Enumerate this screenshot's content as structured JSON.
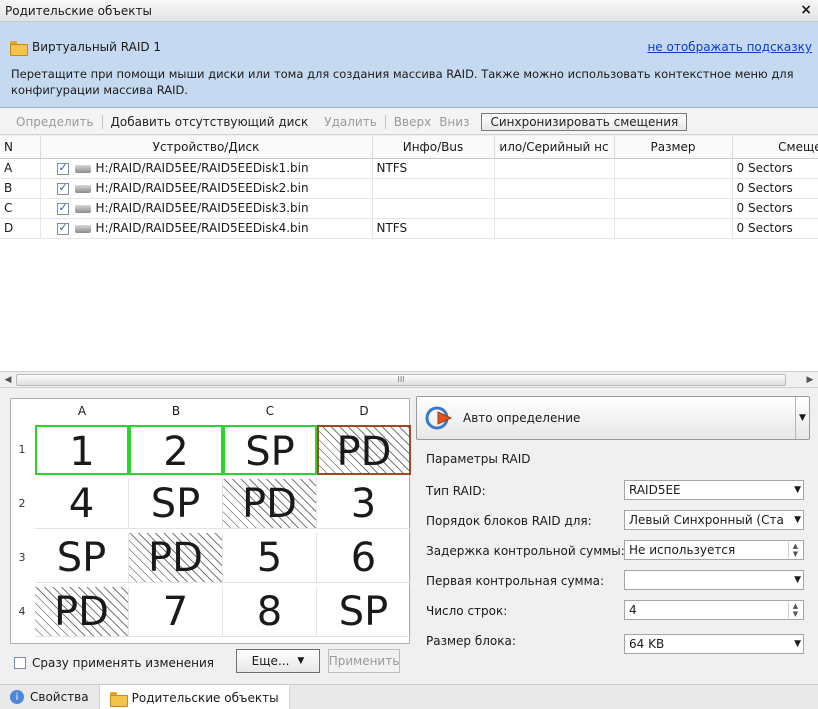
{
  "window": {
    "title": "Родительские объекты",
    "close": "×"
  },
  "hint": {
    "title": "Виртуальный RAID 1",
    "hide_link": "не отображать подсказку",
    "text": "Перетащите при помощи мыши диски или тома для создания массива RAID. Также можно использовать контекстное меню для конфигурации массива RAID."
  },
  "toolbar": {
    "detect": "Определить",
    "add_missing": "Добавить отсутствующий диск",
    "remove": "Удалить",
    "up": "Вверх",
    "down": "Вниз",
    "sync_offsets": "Синхронизировать смещения"
  },
  "grid": {
    "headers": [
      "N",
      "Устройство/Диск",
      "Инфо/Bus",
      "ило/Серийный нс",
      "Размер",
      "Смещен"
    ],
    "rows": [
      {
        "n": "A",
        "checked": true,
        "device": "H:/RAID/RAID5EE/RAID5EEDisk1.bin",
        "info": "NTFS",
        "serial": "",
        "size": "",
        "offset": "0 Sectors"
      },
      {
        "n": "B",
        "checked": true,
        "device": "H:/RAID/RAID5EE/RAID5EEDisk2.bin",
        "info": "",
        "serial": "",
        "size": "",
        "offset": "0 Sectors"
      },
      {
        "n": "C",
        "checked": true,
        "device": "H:/RAID/RAID5EE/RAID5EEDisk3.bin",
        "info": "",
        "serial": "",
        "size": "",
        "offset": "0 Sectors"
      },
      {
        "n": "D",
        "checked": true,
        "device": "H:/RAID/RAID5EE/RAID5EEDisk4.bin",
        "info": "NTFS",
        "serial": "",
        "size": "",
        "offset": "0 Sectors"
      }
    ],
    "scroll_thumb": "III"
  },
  "raid_map": {
    "columns": [
      "A",
      "B",
      "C",
      "D"
    ],
    "rows": [
      "1",
      "2",
      "3",
      "4"
    ],
    "cells": [
      [
        "1",
        "2",
        "SP",
        "PD"
      ],
      [
        "4",
        "SP",
        "PD",
        "3"
      ],
      [
        "SP",
        "PD",
        "5",
        "6"
      ],
      [
        "PD",
        "7",
        "8",
        "SP"
      ]
    ]
  },
  "bottom": {
    "apply_now": "Сразу применять изменения",
    "more": "Еще...",
    "apply": "Применить"
  },
  "params": {
    "auto_detect": "Авто определение",
    "title": "Параметры RAID",
    "raid_type_label": "Тип RAID:",
    "raid_type_value": "RAID5EE",
    "block_order_label": "Порядок блоков RAID для:",
    "block_order_value": "Левый Синхронный (Ста",
    "checksum_delay_label": "Задержка контрольной суммы:",
    "checksum_delay_value": "Не используется",
    "first_checksum_label": "Первая контрольная сумма:",
    "first_checksum_value": "",
    "rows_label": "Число строк:",
    "rows_value": "4",
    "block_size_label": "Размер блока:",
    "block_size_value": "64 KB"
  },
  "tabs": [
    {
      "label": "Свойства"
    },
    {
      "label": "Родительские объекты"
    }
  ]
}
